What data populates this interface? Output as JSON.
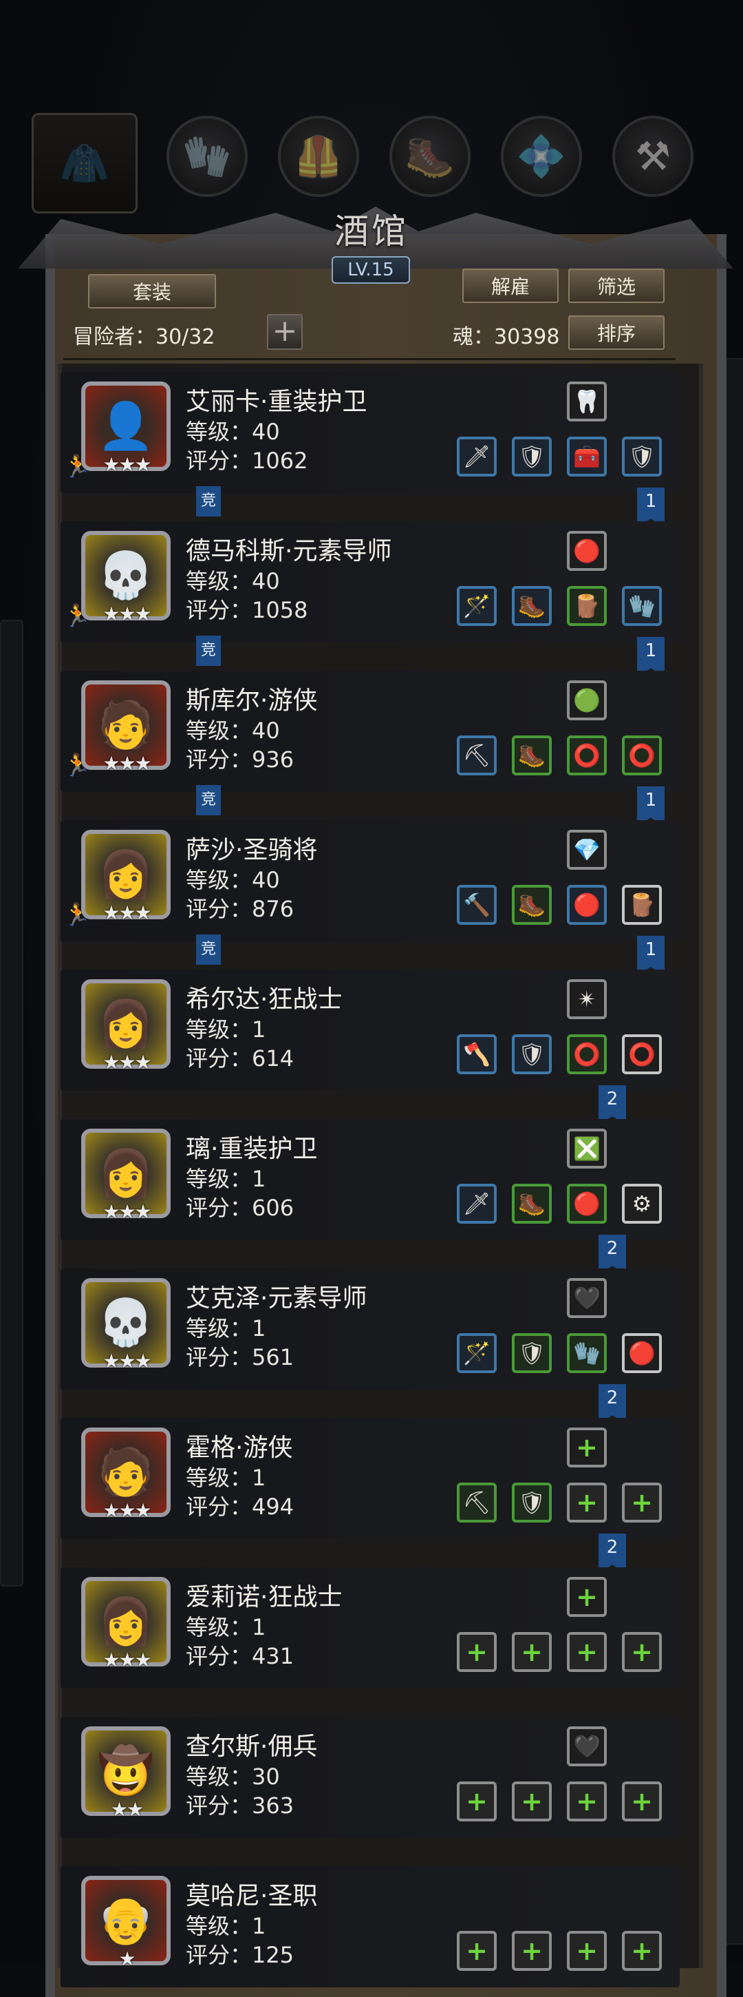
{
  "tabs": [
    {
      "icon": "hood-icon"
    },
    {
      "icon": "glove-icon"
    },
    {
      "icon": "chest-armor-icon"
    },
    {
      "icon": "boots-icon"
    },
    {
      "icon": "crystal-icon"
    },
    {
      "icon": "anvil-icon"
    }
  ],
  "header": {
    "title": "酒馆",
    "level": "LV.15",
    "set_button": "套装",
    "dismiss_button": "解雇",
    "filter_button": "筛选",
    "sort_button": "排序",
    "adventurers_label": "冒险者：30/32",
    "soul_label": "魂：30398"
  },
  "badges": {
    "jing": "竞"
  },
  "heroes": [
    {
      "name": "艾丽卡·重装护卫",
      "level": "等级：40",
      "score": "评分：1062",
      "stars": "★★★",
      "frame": "red",
      "avatar": "👤",
      "runner": true,
      "jing": true,
      "ribbon": "1",
      "acc": {
        "icon": "claw-icon",
        "glyph": "🦷"
      },
      "slots": [
        {
          "c": "blue",
          "g": "🗡"
        },
        {
          "c": "blue",
          "g": "🛡"
        },
        {
          "c": "blue",
          "g": "🧰"
        },
        {
          "c": "blue",
          "g": "🛡"
        }
      ]
    },
    {
      "name": "德马科斯·元素导师",
      "level": "等级：40",
      "score": "评分：1058",
      "stars": "★★★",
      "frame": "gold",
      "avatar": "💀",
      "runner": true,
      "jing": true,
      "ribbon": "1",
      "acc": {
        "icon": "red-gem-icon",
        "glyph": "🔴"
      },
      "slots": [
        {
          "c": "blue",
          "g": "🪄"
        },
        {
          "c": "blue",
          "g": "🥾"
        },
        {
          "c": "green",
          "g": "🪵"
        },
        {
          "c": "blue",
          "g": "🧤"
        }
      ]
    },
    {
      "name": "斯库尔·游侠",
      "level": "等级：40",
      "score": "评分：936",
      "stars": "★★★",
      "frame": "red",
      "avatar": "🧑",
      "runner": true,
      "jing": true,
      "ribbon": "1",
      "acc": {
        "icon": "green-gem-icon",
        "glyph": "🟢"
      },
      "slots": [
        {
          "c": "blue",
          "g": "⛏"
        },
        {
          "c": "green",
          "g": "🥾"
        },
        {
          "c": "green",
          "g": "⭕"
        },
        {
          "c": "green",
          "g": "⭕"
        }
      ]
    },
    {
      "name": "萨沙·圣骑将",
      "level": "等级：40",
      "score": "评分：876",
      "stars": "★★★",
      "frame": "gold",
      "avatar": "👩",
      "runner": true,
      "jing": true,
      "ribbon": "1",
      "acc": {
        "icon": "purple-crystal-icon",
        "glyph": "💎"
      },
      "slots": [
        {
          "c": "blue",
          "g": "🔨"
        },
        {
          "c": "green",
          "g": "🥾"
        },
        {
          "c": "blue",
          "g": "🔴"
        },
        {
          "c": "white",
          "g": "🪵"
        }
      ]
    },
    {
      "name": "希尔达·狂战士",
      "level": "等级：1",
      "score": "评分：614",
      "stars": "★★★",
      "frame": "gold",
      "avatar": "👩",
      "runner": false,
      "jing": false,
      "ribbon": "2",
      "acc": {
        "icon": "rune-icon",
        "glyph": "✴"
      },
      "slots": [
        {
          "c": "blue",
          "g": "🪓"
        },
        {
          "c": "blue",
          "g": "🛡"
        },
        {
          "c": "green",
          "g": "⭕"
        },
        {
          "c": "white",
          "g": "⭕"
        }
      ]
    },
    {
      "name": "璃·重装护卫",
      "level": "等级：1",
      "score": "评分：606",
      "stars": "★★★",
      "frame": "gold",
      "avatar": "👩",
      "runner": false,
      "jing": false,
      "ribbon": "2",
      "acc": {
        "icon": "green-rune-icon",
        "glyph": "❎"
      },
      "slots": [
        {
          "c": "blue",
          "g": "🗡"
        },
        {
          "c": "green",
          "g": "🥾"
        },
        {
          "c": "green",
          "g": "🔴"
        },
        {
          "c": "white",
          "g": "⚙"
        }
      ]
    },
    {
      "name": "艾克泽·元素导师",
      "level": "等级：1",
      "score": "评分：561",
      "stars": "★★★",
      "frame": "gold",
      "avatar": "💀",
      "runner": false,
      "jing": false,
      "ribbon": "2",
      "acc": {
        "icon": "black-claw-icon",
        "glyph": "🖤"
      },
      "slots": [
        {
          "c": "blue",
          "g": "🪄"
        },
        {
          "c": "green",
          "g": "🛡"
        },
        {
          "c": "green",
          "g": "🧤"
        },
        {
          "c": "white",
          "g": "🔴"
        }
      ]
    },
    {
      "name": "霍格·游侠",
      "level": "等级：1",
      "score": "评分：494",
      "stars": "★★★",
      "frame": "red",
      "avatar": "🧑",
      "runner": false,
      "jing": false,
      "ribbon": "2",
      "acc": {
        "icon": "add-icon",
        "glyph": "+"
      },
      "slots": [
        {
          "c": "green",
          "g": "⛏"
        },
        {
          "c": "green",
          "g": "🛡"
        },
        {
          "c": "gray",
          "g": "+"
        },
        {
          "c": "gray",
          "g": "+"
        }
      ]
    },
    {
      "name": "爱莉诺·狂战士",
      "level": "等级：1",
      "score": "评分：431",
      "stars": "★★★",
      "frame": "gold",
      "avatar": "👩",
      "runner": false,
      "jing": false,
      "ribbon": "",
      "acc": {
        "icon": "add-icon",
        "glyph": "+"
      },
      "slots": [
        {
          "c": "gray",
          "g": "+"
        },
        {
          "c": "gray",
          "g": "+"
        },
        {
          "c": "gray",
          "g": "+"
        },
        {
          "c": "gray",
          "g": "+"
        }
      ]
    },
    {
      "name": "查尔斯·佣兵",
      "level": "等级：30",
      "score": "评分：363",
      "stars": "★★",
      "frame": "gold",
      "avatar": "🤠",
      "runner": false,
      "jing": false,
      "ribbon": "",
      "acc": {
        "icon": "black-claw-icon",
        "glyph": "🖤"
      },
      "slots": [
        {
          "c": "gray",
          "g": "+"
        },
        {
          "c": "gray",
          "g": "+"
        },
        {
          "c": "gray",
          "g": "+"
        },
        {
          "c": "gray",
          "g": "+"
        }
      ]
    },
    {
      "name": "莫哈尼·圣职",
      "level": "等级：1",
      "score": "评分：125",
      "stars": "★",
      "frame": "red",
      "avatar": "👴",
      "runner": false,
      "jing": false,
      "ribbon": "",
      "acc": null,
      "slots": [
        {
          "c": "gray",
          "g": "+"
        },
        {
          "c": "gray",
          "g": "+"
        },
        {
          "c": "gray",
          "g": "+"
        },
        {
          "c": "gray",
          "g": "+"
        }
      ]
    }
  ]
}
